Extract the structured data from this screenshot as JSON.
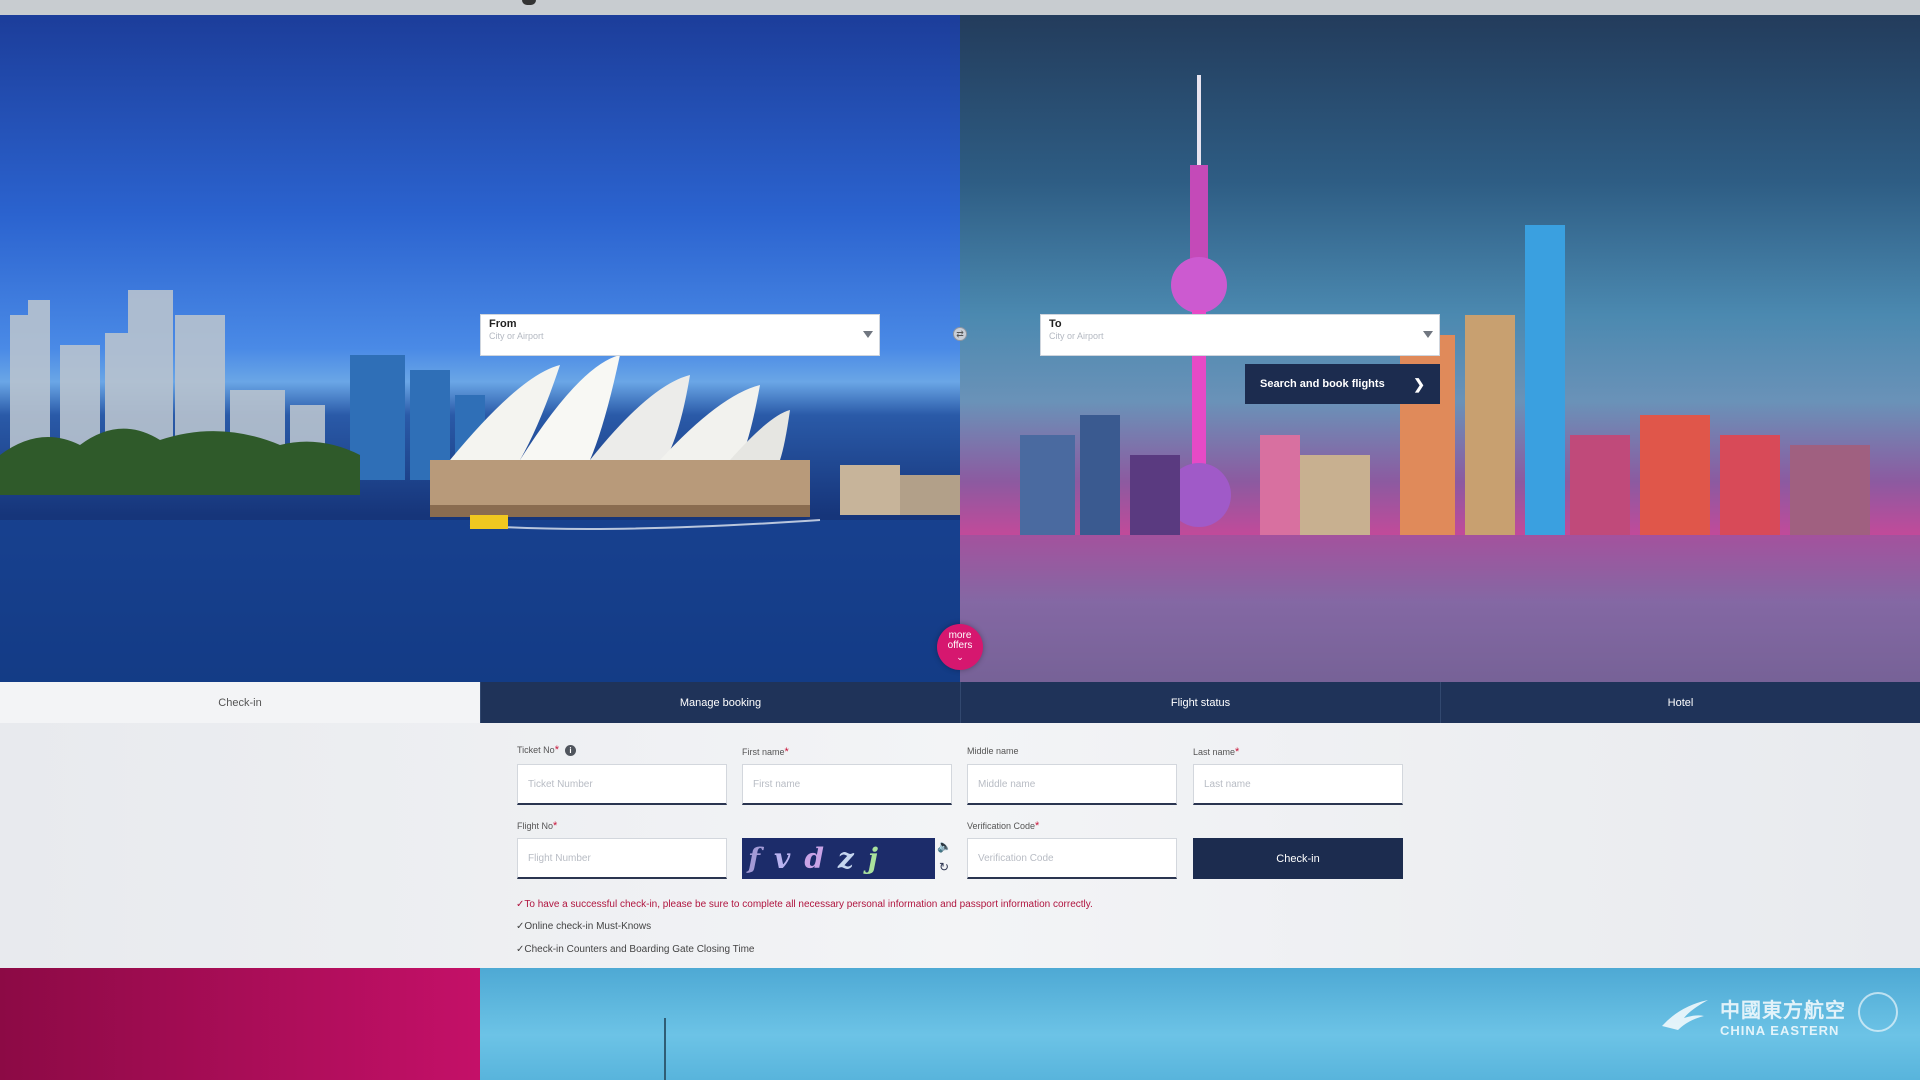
{
  "hero": {
    "from_label": "From",
    "from_placeholder": "City or Airport",
    "to_label": "To",
    "to_placeholder": "City or Airport",
    "search_button": "Search and book flights",
    "more_offers": "more offers"
  },
  "tabs": [
    {
      "label": "Check-in",
      "active": true
    },
    {
      "label": "Manage booking"
    },
    {
      "label": "Flight status"
    },
    {
      "label": "Hotel"
    }
  ],
  "form": {
    "ticket_label": "Ticket No",
    "ticket_placeholder": "Ticket Number",
    "first_label": "First name",
    "first_placeholder": "First name",
    "middle_label": "Middle name",
    "middle_placeholder": "Middle name",
    "last_label": "Last name",
    "last_placeholder": "Last name",
    "flight_label": "Flight No",
    "flight_placeholder": "Flight Number",
    "verify_label": "Verification Code",
    "verify_placeholder": "Verification Code",
    "captcha_chars": [
      "f",
      "v",
      "d",
      "z",
      "j"
    ],
    "checkin_button": "Check-in"
  },
  "notes": {
    "warning": "✓To have a successful check-in, please be sure to complete all necessary personal information and passport information correctly.",
    "must_knows": "✓Online check-in Must-Knows",
    "closing_time": "✓Check-in Counters and Boarding Gate Closing Time"
  },
  "brand": {
    "name_cn": "中國東方航空",
    "name_en": "CHINA EASTERN"
  },
  "colors": {
    "navy": "#1c2c4f",
    "accent_pink": "#d6176f",
    "required_red": "#c8163a"
  }
}
